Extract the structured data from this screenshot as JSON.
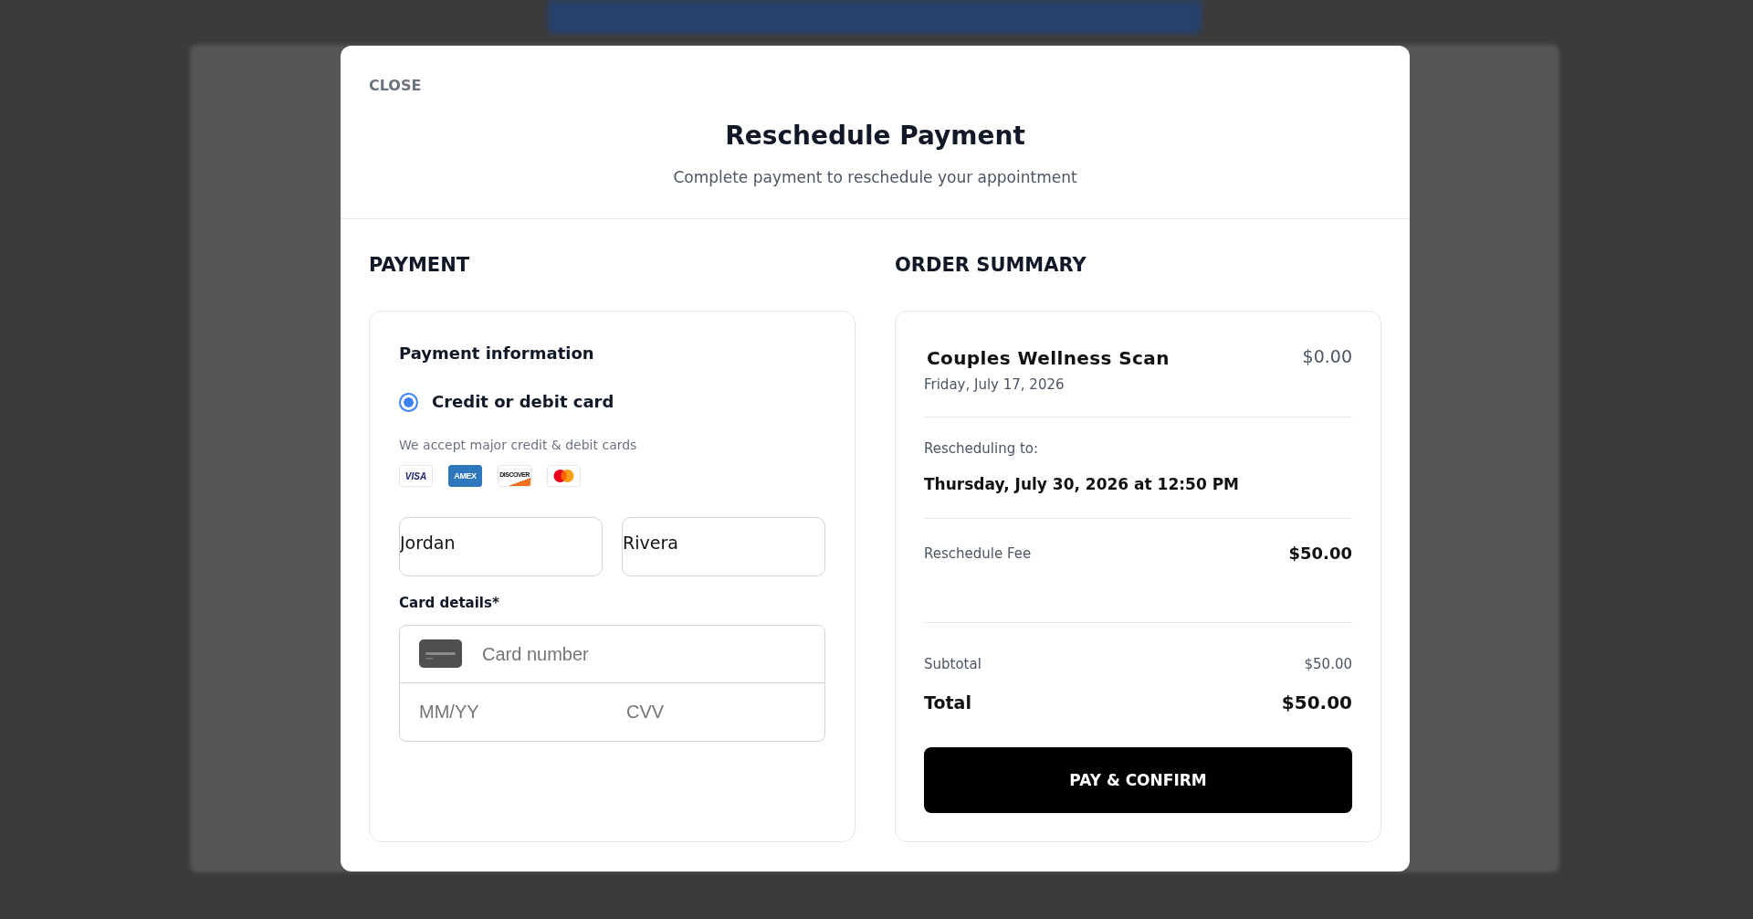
{
  "close": "CLOSE",
  "title": "Reschedule Payment",
  "subtitle": "Complete payment to reschedule your appointment",
  "payment": {
    "heading": "PAYMENT",
    "panel_title": "Payment information",
    "options": [
      {
        "label": "Credit or debit card",
        "selected": true
      }
    ],
    "accepted_note": "We accept major credit & debit cards",
    "card_logos": [
      {
        "kind": "visa",
        "label": "VISA"
      },
      {
        "kind": "amex",
        "label": "AMEX"
      },
      {
        "kind": "discover",
        "label": "DISCOVER"
      },
      {
        "kind": "mastercard"
      }
    ],
    "name_fields": [
      {
        "value": "Jordan"
      },
      {
        "value": "Rivera"
      }
    ],
    "card_details": {
      "label": "Card details*",
      "number_placeholder": "Card number",
      "expiry_placeholder": "MM/YY",
      "cvv_placeholder": "CVV"
    }
  },
  "order_summary": {
    "heading": "ORDER SUMMARY",
    "item": {
      "name": "Couples Wellness Scan",
      "date": "Friday, July 17, 2026",
      "price": "$0.00"
    },
    "reschedule": {
      "label": "Rescheduling to:",
      "value": "Thursday, July 30, 2026 at 12:50 PM"
    },
    "fee": {
      "label": "Reschedule Fee",
      "amount": "$50.00"
    },
    "subtotal": {
      "label": "Subtotal",
      "amount": "$50.00"
    },
    "total": {
      "label": "Total",
      "amount": "$50.00"
    },
    "button": "PAY & CONFIRM"
  }
}
